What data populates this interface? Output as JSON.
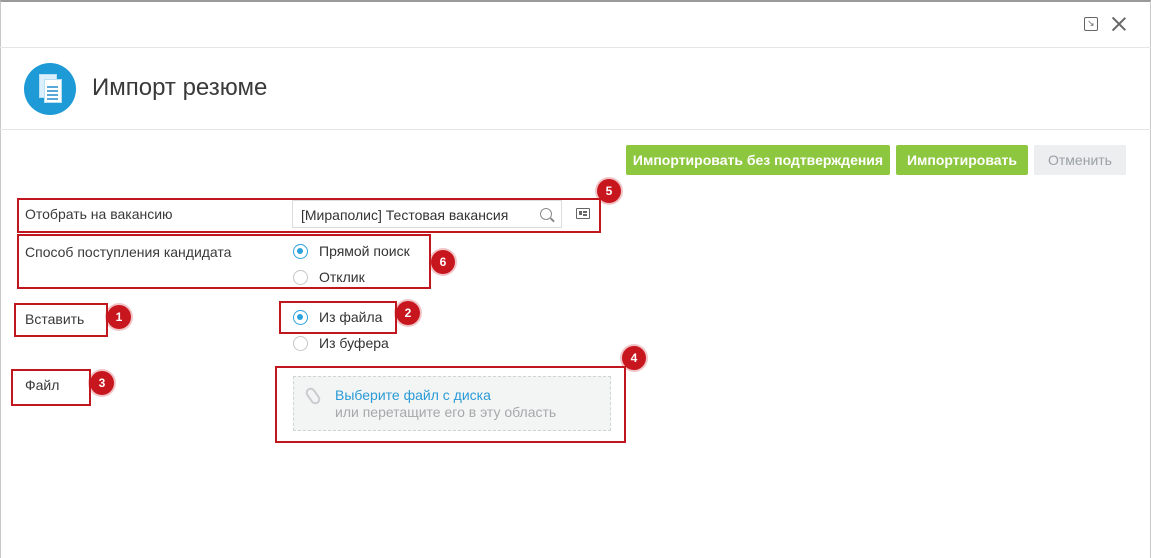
{
  "window": {
    "restore_icon": "restore-icon",
    "close_icon": "close-icon"
  },
  "header": {
    "title": "Импорт резюме",
    "icon": "documents-icon",
    "icon_color": "#1e9bd7"
  },
  "toolbar": {
    "import_without_confirm_label": "Импортировать без подтверждения",
    "import_label": "Импортировать",
    "cancel_label": "Отменить",
    "accent_color": "#8dc63f"
  },
  "form": {
    "vacancy": {
      "label": "Отобрать на вакансию",
      "value": "[Мираполис] Тестовая вакансия",
      "search_icon": "search-icon",
      "card_icon": "card-icon"
    },
    "source": {
      "label": "Способ поступления кандидата",
      "options": [
        {
          "label": "Прямой поиск",
          "checked": true
        },
        {
          "label": "Отклик",
          "checked": false
        }
      ]
    },
    "insert": {
      "label": "Вставить",
      "options": [
        {
          "label": "Из файла",
          "checked": true
        },
        {
          "label": "Из буфера",
          "checked": false
        }
      ]
    },
    "file": {
      "label": "Файл",
      "link_text": "Выберите файл с диска",
      "hint_text": "или перетащите его в эту область",
      "clip_icon": "paperclip-icon"
    }
  },
  "annotations": {
    "color": "#c0171f",
    "badges": [
      "1",
      "2",
      "3",
      "4",
      "5",
      "6"
    ]
  }
}
